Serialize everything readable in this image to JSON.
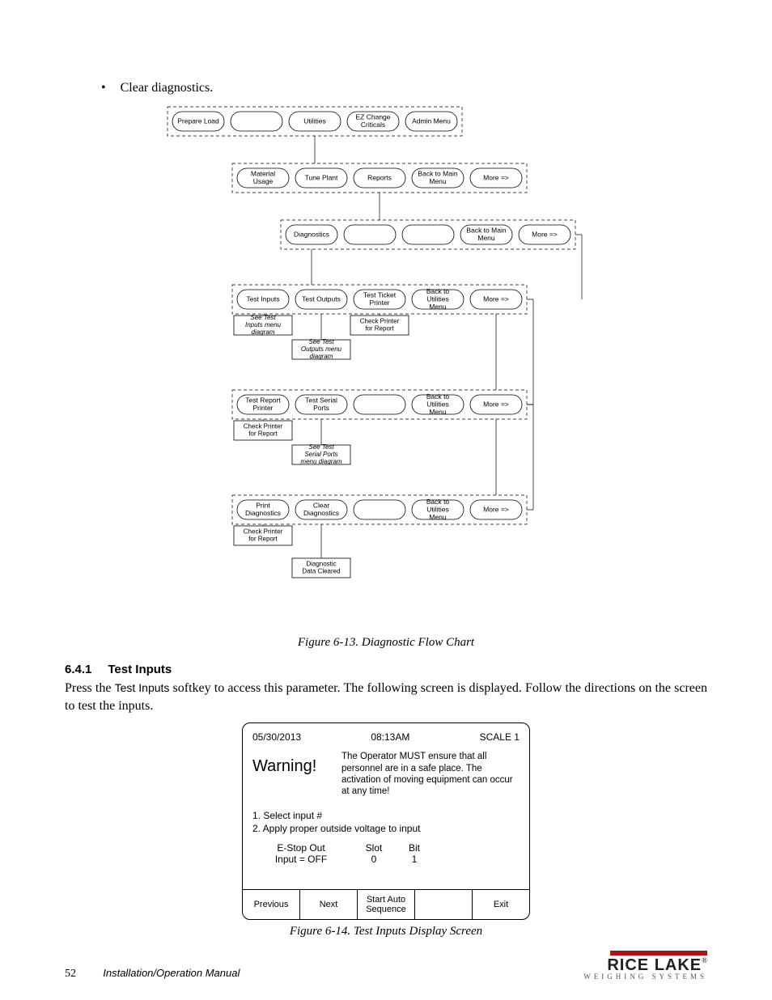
{
  "bullet": "Clear diagnostics.",
  "figure13_caption": "Figure 6-13. Diagnostic Flow Chart",
  "section": {
    "num": "6.4.1",
    "title": "Test Inputs"
  },
  "body_prefix": "Press the ",
  "body_softkey": "Test Inputs",
  "body_suffix": " softkey to access this parameter. The following screen is displayed. Follow the directions on the screen to test the inputs.",
  "chart_data": {
    "type": "flowchart",
    "rows": [
      {
        "items": [
          "Prepare Load",
          "",
          "Utilities",
          "EZ Change Criticals",
          "Admin Menu"
        ]
      },
      {
        "items": [
          "Material Usage",
          "Tune Plant",
          "Reports",
          "Back to Main Menu",
          "More =>"
        ]
      },
      {
        "items": [
          "Diagnostics",
          "",
          "",
          "Back to Main Menu",
          "More =>"
        ]
      },
      {
        "items": [
          "Test Inputs",
          "Test Outputs",
          "Test Ticket Printer",
          "Back to Utilities Menu",
          "More =>"
        ],
        "below": [
          {
            "col": 0,
            "text": "See Test Inputs menu diagram",
            "italic": true,
            "box": true
          },
          {
            "col": 2,
            "text": "Check Printer for Report",
            "box": true
          },
          {
            "col": 1,
            "text": "See Test Outputs menu diagram",
            "italic": true,
            "box": true,
            "offsetY": 30
          }
        ]
      },
      {
        "items": [
          "Test Report Printer",
          "Test Serial Ports",
          "",
          "Back to Utilities Menu",
          "More =>"
        ],
        "below": [
          {
            "col": 0,
            "text": "Check Printer for Report",
            "box": true
          },
          {
            "col": 1,
            "text": "See Test Serial Ports menu diagram",
            "italic": true,
            "box": true,
            "offsetY": 30
          }
        ]
      },
      {
        "items": [
          "Print Diagnostics",
          "Clear Diagnostics",
          "",
          "Back to Utilities Menu",
          "More =>"
        ],
        "below": [
          {
            "col": 0,
            "text": "Check Printer for Report",
            "box": true
          },
          {
            "col": 1,
            "text": "Diagnostic Data Cleared",
            "box": true,
            "offsetY": 40
          }
        ]
      }
    ]
  },
  "display": {
    "date": "05/30/2013",
    "time": "08:13AM",
    "scale": "SCALE 1",
    "warning_label": "Warning!",
    "warning_text": "The Operator MUST ensure that all personnel are in a safe place. The activation of moving equipment can occur at any time!",
    "step1": "1. Select input #",
    "step2": "2. Apply proper outside voltage to input",
    "mid": {
      "label1a": "E-Stop Out",
      "label1b": "Input = OFF",
      "slot_h": "Slot",
      "slot_v": "0",
      "bit_h": "Bit",
      "bit_v": "1"
    },
    "softkeys": [
      "Previous",
      "Next",
      "Start Auto Sequence",
      "",
      "Exit"
    ]
  },
  "figure14_caption": "Figure 6-14. Test Inputs Display Screen",
  "footer": {
    "page": "52",
    "manual": "Installation/Operation Manual",
    "logo_name": "RICE LAKE",
    "logo_tag": "WEIGHING SYSTEMS"
  }
}
